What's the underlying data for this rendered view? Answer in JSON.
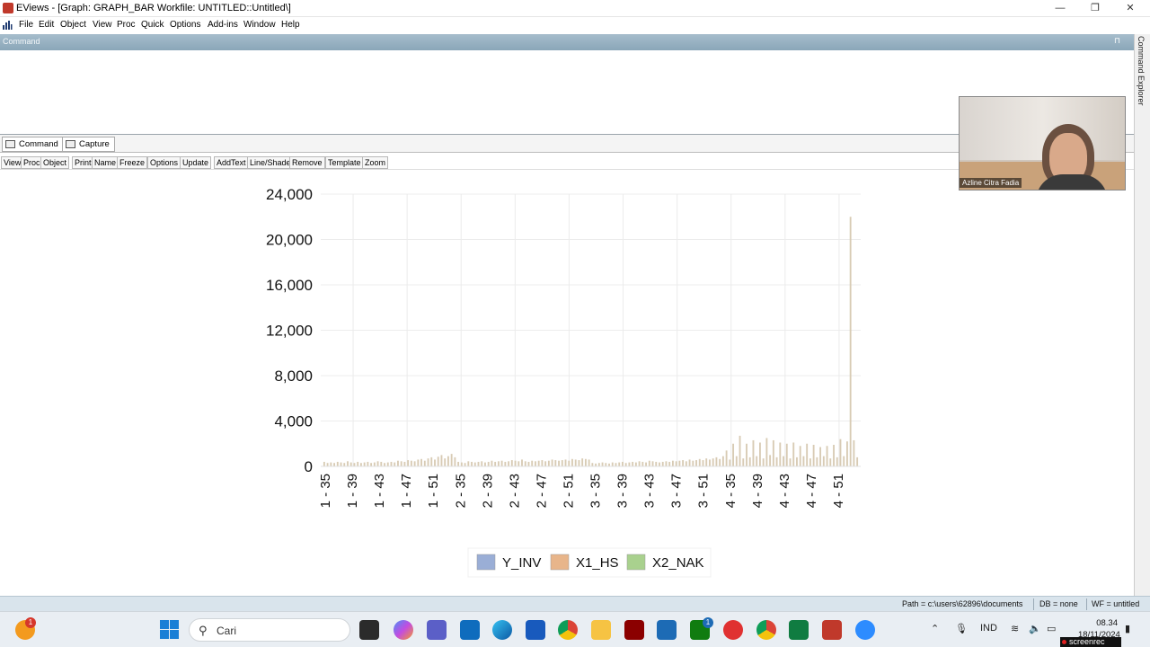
{
  "window": {
    "title": "EViews - [Graph: GRAPH_BAR   Workfile: UNTITLED::Untitled\\]",
    "controls": [
      "—",
      "❐",
      "✕"
    ]
  },
  "menu": [
    "File",
    "Edit",
    "Object",
    "View",
    "Proc",
    "Quick",
    "Options",
    "Add-ins",
    "Window",
    "Help"
  ],
  "command_pane": {
    "label": "Command",
    "side_label": "Command Explorer"
  },
  "tabs": [
    "Command",
    "Capture"
  ],
  "graph_toolbar": [
    "View",
    "Proc",
    "Object",
    "Print",
    "Name",
    "Freeze",
    "Options",
    "Update",
    "AddText",
    "Line/Shade",
    "Remove",
    "Template",
    "Zoom"
  ],
  "webcam": {
    "name": "Azline Citra Fadia"
  },
  "status": {
    "path": "Path = c:\\users\\62896\\documents",
    "db": "DB = none",
    "wf": "WF = untitled"
  },
  "taskbar": {
    "search_placeholder": "Cari",
    "lang": "IND",
    "time": "08.34",
    "date": "18/11/2024",
    "notification_badge": "1",
    "teams_badge": "1",
    "screenrec": "screenrec"
  },
  "colors": {
    "y_inv": "#9aaed6",
    "x1_hs": "#e8b58a",
    "x2_nak": "#a9d18e",
    "bar": "#d8cbb4",
    "grid": "#ececec"
  },
  "chart_data": {
    "type": "bar",
    "title": "",
    "xlabel": "",
    "ylabel": "",
    "ylim": [
      0,
      24000
    ],
    "yticks": [
      "24,000",
      "20,000",
      "16,000",
      "12,000",
      "8,000",
      "4,000",
      "0"
    ],
    "x_tick_labels": [
      "1 - 35",
      "1 - 39",
      "1 - 43",
      "1 - 47",
      "1 - 51",
      "2 - 35",
      "2 - 39",
      "2 - 43",
      "2 - 47",
      "2 - 51",
      "3 - 35",
      "3 - 39",
      "3 - 43",
      "3 - 47",
      "3 - 51",
      "4 - 35",
      "4 - 39",
      "4 - 43",
      "4 - 47",
      "4 - 51"
    ],
    "legend": [
      "Y_INV",
      "X1_HS",
      "X2_NAK"
    ],
    "grid": true,
    "legend_position": "bottom",
    "series_values": [
      400,
      300,
      350,
      300,
      400,
      350,
      300,
      450,
      350,
      300,
      400,
      300,
      350,
      400,
      300,
      350,
      450,
      400,
      300,
      350,
      400,
      350,
      500,
      450,
      400,
      550,
      500,
      450,
      600,
      650,
      500,
      700,
      800,
      600,
      850,
      1000,
      700,
      900,
      1100,
      800,
      400,
      350,
      300,
      450,
      400,
      350,
      400,
      450,
      350,
      400,
      500,
      400,
      450,
      500,
      400,
      450,
      550,
      500,
      450,
      600,
      450,
      400,
      500,
      450,
      500,
      550,
      450,
      500,
      600,
      550,
      500,
      550,
      600,
      500,
      650,
      600,
      550,
      700,
      650,
      600,
      300,
      250,
      300,
      350,
      300,
      250,
      350,
      300,
      350,
      400,
      300,
      350,
      400,
      350,
      450,
      400,
      350,
      500,
      450,
      400,
      350,
      400,
      450,
      400,
      500,
      450,
      500,
      550,
      450,
      600,
      500,
      550,
      650,
      550,
      700,
      600,
      700,
      800,
      650,
      900,
      1400,
      600,
      2000,
      900,
      2700,
      700,
      2000,
      800,
      2300,
      900,
      2100,
      700,
      2500,
      1000,
      2300,
      800,
      2100,
      900,
      2000,
      700,
      2100,
      800,
      1800,
      900,
      2000,
      700,
      1900,
      800,
      1700,
      900,
      1800,
      700,
      1900,
      800,
      2400,
      900,
      2200,
      22000,
      2300,
      800
    ]
  }
}
